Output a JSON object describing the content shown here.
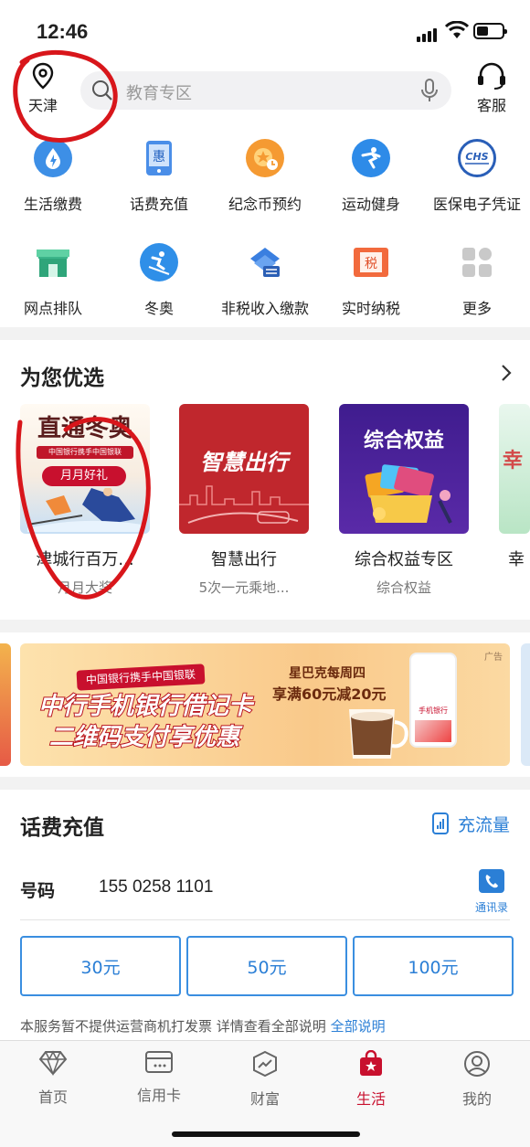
{
  "status_bar": {
    "time": "12:46"
  },
  "header": {
    "location": "天津",
    "search_placeholder": "教育专区",
    "service_label": "客服"
  },
  "quick_grid": [
    {
      "label": "生活缴费",
      "icon": "lightning-drop-icon"
    },
    {
      "label": "话费充值",
      "icon": "phone-recharge-icon"
    },
    {
      "label": "纪念币预约",
      "icon": "commemorative-coin-icon"
    },
    {
      "label": "运动健身",
      "icon": "skating-icon"
    },
    {
      "label": "医保电子凭证",
      "icon": "chs-medical-insurance-icon"
    },
    {
      "label": "网点排队",
      "icon": "branch-store-icon"
    },
    {
      "label": "冬奥",
      "icon": "skiing-icon"
    },
    {
      "label": "非税收入缴款",
      "icon": "layers-payment-icon"
    },
    {
      "label": "实时纳税",
      "icon": "tax-icon"
    },
    {
      "label": "更多",
      "icon": "more-grid-icon"
    }
  ],
  "recommend": {
    "title": "为您优选",
    "cards": [
      {
        "title": "津城行百万...",
        "sub": "月月大奖",
        "img_title": "直通冬奥",
        "img_badge": "月月好礼",
        "img_ribbon": "中国银行携手中国银联"
      },
      {
        "title": "智慧出行",
        "sub": "5次一元乘地...",
        "img_text": "智慧出行"
      },
      {
        "title": "综合权益专区",
        "sub": "综合权益",
        "img_text": "综合权益"
      },
      {
        "title": "幸",
        "sub": "",
        "img_text": "幸"
      }
    ]
  },
  "banner": {
    "ribbon": "中国银行携手中国银联",
    "line1": "中行手机银行借记卡",
    "line2": "二维码支付享优惠",
    "promo_title": "星巴克每周四",
    "promo_offer": "享满60元减20元",
    "ad_tag": "广告",
    "phone_label": "手机银行"
  },
  "topup": {
    "title": "话费充值",
    "flow_label": "充流量",
    "number_label": "号码",
    "number_value": "155 0258 1101",
    "contacts_label": "通讯录",
    "amounts": [
      "30元",
      "50元",
      "100元"
    ],
    "note": "本服务暂不提供运营商机打发票 详情查看全部说明",
    "note_link": "全部说明"
  },
  "tabbar": {
    "items": [
      "首页",
      "信用卡",
      "财富",
      "生活",
      "我的"
    ],
    "active": "生活"
  },
  "colors": {
    "accent_blue": "#2b7fd6",
    "brand_red": "#c8102e",
    "annotation_red": "#d8161b"
  }
}
